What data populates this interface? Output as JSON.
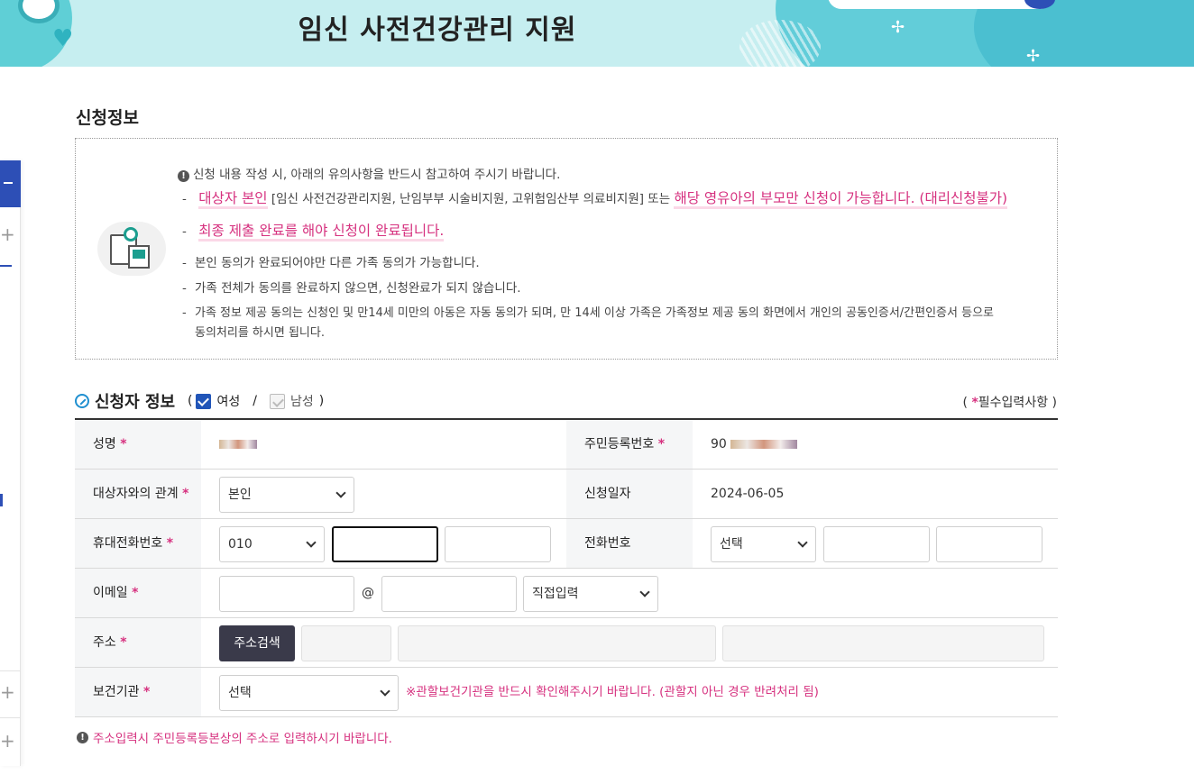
{
  "banner": {
    "title": "임신 사전건강관리 지원"
  },
  "section": {
    "title": "신청정보"
  },
  "notice": {
    "header": "신청 내용 작성 시, 아래의 유의사항을 반드시 참고하여 주시기 바랍니다.",
    "line1_highlight_a": "대상자 본인",
    "line1_middle": "[임신 사전건강관리지원, 난임부부 시술비지원, 고위험임산부 의료비지원] 또는",
    "line1_highlight_b": "해당 영유아의 부모만 신청이 가능합니다. (대리신청불가)",
    "line2_highlight": "최종 제출 완료를 해야 신청이 완료됩니다.",
    "line3": "본인 동의가 완료되어야만 다른 가족 동의가 가능합니다.",
    "line4": "가족 전체가 동의를 완료하지 않으면, 신청완료가 되지 않습니다.",
    "line5a": "가족 정보 제공 동의는 신청인 및 만14세 미만의 아동은 자동 동의가 되며, 만 14세 이상 가족은 가족정보 제공 동의 화면에서 개인의 공동인증서/간편인증서 등으로",
    "line5b": "동의처리를 하시면 됩니다."
  },
  "applicant": {
    "title": "신청자 정보",
    "paren_open": "(",
    "paren_close": ")",
    "slash": "/",
    "female_label": "여성",
    "male_label": "남성",
    "required_open": "(",
    "required_star": "*",
    "required_text": "필수입력사항",
    "required_close": ")"
  },
  "form": {
    "name_label": "성명",
    "name_value_masked": "이*",
    "rrn_label": "주민등록번호",
    "rrn_value_prefix": "90",
    "relation_label": "대상자와의 관계",
    "relation_value": "본인",
    "apply_date_label": "신청일자",
    "apply_date_value": "2024-06-05",
    "mobile_label": "휴대전화번호",
    "mobile_prefix": "010",
    "phone_label": "전화번호",
    "phone_prefix": "선택",
    "email_label": "이메일",
    "email_at": "@",
    "email_domain_select": "직접입력",
    "address_label": "주소",
    "address_button": "주소검색",
    "center_label": "보건기관",
    "center_select": "선택",
    "center_warning": "※관할보건기관을 반드시 확인해주시기 바랍니다. (관할지 아닌 경우 반려처리 됨)",
    "star": "*"
  },
  "bottom_note": "주소입력시 주민등록등본상의 주소로 입력하시기 바랍니다.",
  "colors": {
    "accent_pink": "#d6317f",
    "brand_blue": "#2d4fb6",
    "banner_bg": "#c6eef0"
  }
}
